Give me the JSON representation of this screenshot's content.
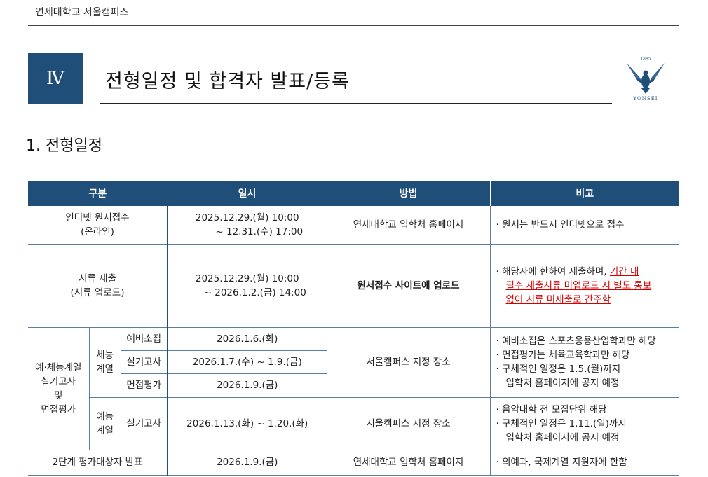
{
  "header": {
    "campus": "연세대학교 서울캠퍼스"
  },
  "section": {
    "number": "Ⅳ",
    "title": "전형일정 및 합격자 발표/등록"
  },
  "logo": {
    "year": "1885",
    "name": "YONSEI"
  },
  "subsection": {
    "title": "1. 전형일정"
  },
  "table": {
    "headers": [
      "구분",
      "일시",
      "방법",
      "비고"
    ],
    "row1": {
      "category": [
        "인터넷 원서접수",
        "(온라인)"
      ],
      "date": [
        "2025.12.29.(월) 10:00",
        "~ 12.31.(수) 17:00"
      ],
      "method": "연세대학교 입학처 홈페이지",
      "note": "· 원서는 반드시 인터넷으로 접수"
    },
    "row2": {
      "category": [
        "서류 제출",
        "(서류 업로드)"
      ],
      "date": [
        "2025.12.29.(월) 10:00",
        "~ 2026.1.2.(금) 14:00"
      ],
      "method": "원서접수 사이트에 업로드",
      "note_plain": "· 해당자에 한하여 제출하며, ",
      "note_red_1": "기간 내",
      "note_red_2": "필수 제출서류 미업로드 시 별도 통보",
      "note_red_3": "없이 서류 미제출로 간주함"
    },
    "row3": {
      "category": [
        "예·체능계열",
        "실기고사",
        "및",
        "면접평가"
      ],
      "group_sports": [
        "체능",
        "계열"
      ],
      "group_arts": [
        "예능",
        "계열"
      ],
      "sub1": {
        "label": "예비소집",
        "date": "2026.1.6.(화)"
      },
      "sub2": {
        "label": "실기고사",
        "date": "2026.1.7.(수) ~ 1.9.(금)"
      },
      "sub3": {
        "label": "면접평가",
        "date": "2026.1.9.(금)"
      },
      "sports_method": "서울캠퍼스 지정 장소",
      "sports_notes": [
        "· 예비소집은 스포츠응용산업학과만 해당",
        "· 면접평가는 체육교육학과만 해당",
        "· 구체적인 일정은 1.5.(월)까지",
        "  입학처 홈페이지에 공지 예정"
      ],
      "arts_label": "실기고사",
      "arts_date": "2026.1.13.(화) ~ 1.20.(화)",
      "arts_method": "서울캠퍼스 지정 장소",
      "arts_notes": [
        "· 음악대학 전 모집단위 해당",
        "· 구체적인 일정은 1.11.(일)까지",
        "  입학처 홈페이지에 공지 예정"
      ]
    },
    "row4": {
      "category": "2단계 평가대상자 발표",
      "date": "2026.1.9.(금)",
      "method": "연세대학교 입학처 홈페이지",
      "note": "· 의예과, 국제계열 지원자에 한함"
    }
  }
}
